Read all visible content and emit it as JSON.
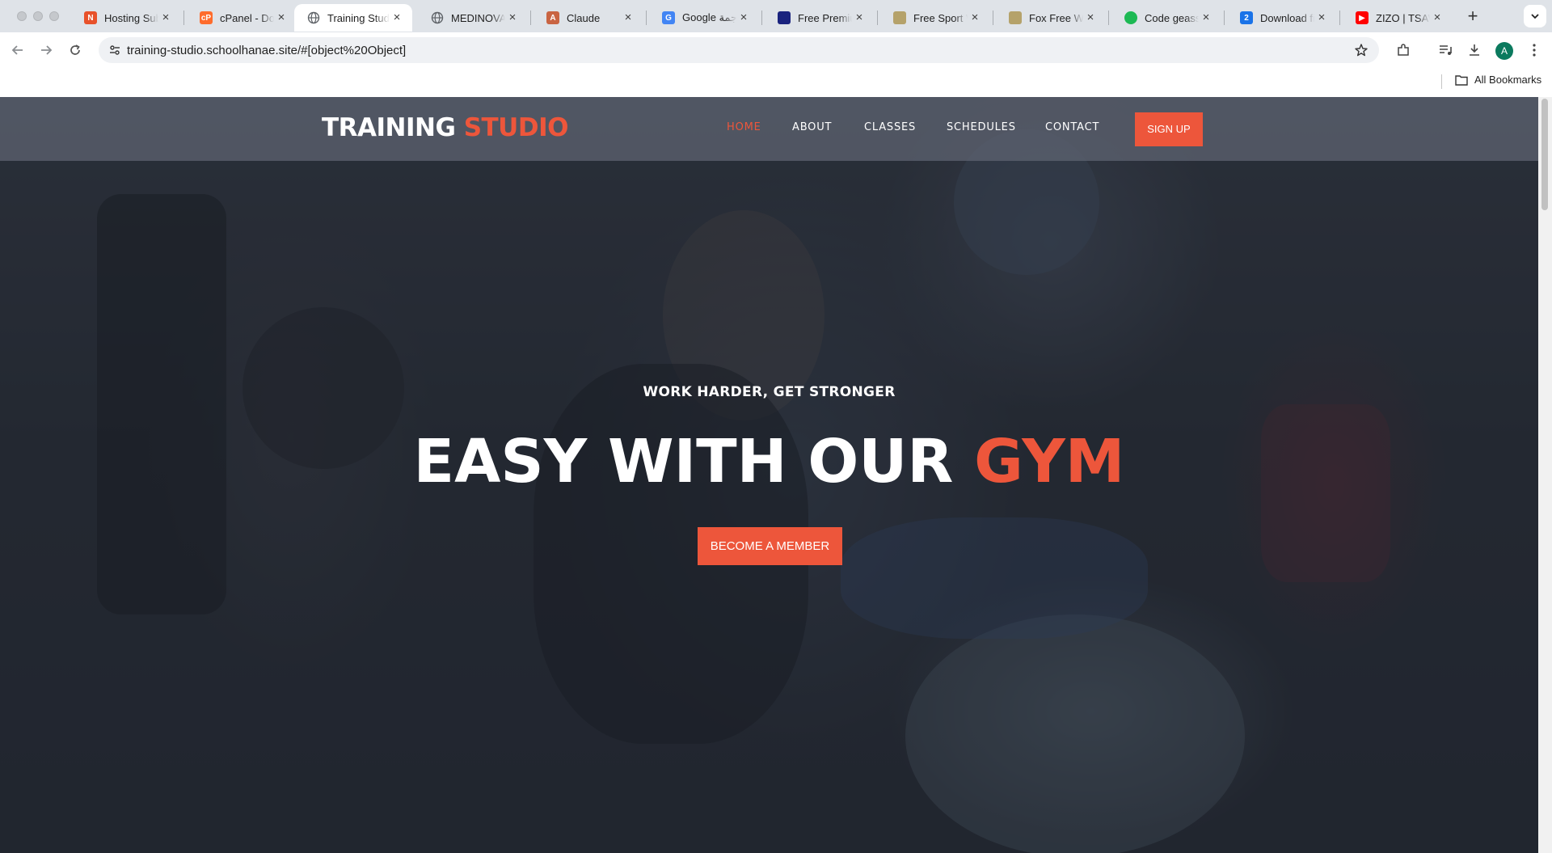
{
  "browser": {
    "tabs": [
      {
        "label": "Hosting Subs",
        "favicon": "hosting-icon",
        "color": "#e8512a",
        "active": false
      },
      {
        "label": "cPanel - Dom",
        "favicon": "cpanel-icon",
        "color": "#ff6c2c",
        "active": false
      },
      {
        "label": "Training Stud",
        "favicon": "globe-icon",
        "color": "#5f6368",
        "active": true
      },
      {
        "label": "MEDINOVA - ",
        "favicon": "globe-icon",
        "color": "#5f6368",
        "active": false
      },
      {
        "label": "Claude",
        "favicon": "claude-icon",
        "color": "#c96442",
        "active": false
      },
      {
        "label": "Google ترجمة",
        "favicon": "translate-icon",
        "color": "#4285f4",
        "active": false
      },
      {
        "label": "Free Premium",
        "favicon": "premium-icon",
        "color": "#1a237e",
        "active": false
      },
      {
        "label": "Free Sport W",
        "favicon": "sport-icon",
        "color": "#b5a26a",
        "active": false
      },
      {
        "label": "Fox Free Web",
        "favicon": "fox-icon",
        "color": "#b5a26a",
        "active": false
      },
      {
        "label": "Code geass",
        "favicon": "spotify-icon",
        "color": "#1db954",
        "active": false
      },
      {
        "label": "Download fil",
        "favicon": "download-site-icon",
        "color": "#1a73e8",
        "active": false
      },
      {
        "label": "ZIZO | TSAW",
        "favicon": "youtube-icon",
        "color": "#ff0000",
        "active": false
      }
    ],
    "url": "training-studio.schoolhanae.site/#[object%20Object]",
    "avatar_letter": "A",
    "bookmarks_label": "All Bookmarks"
  },
  "site": {
    "logo_main": "TRAINING ",
    "logo_accent": "STUDIO",
    "nav": [
      {
        "label": "HOME",
        "active": true
      },
      {
        "label": "ABOUT",
        "active": false
      },
      {
        "label": "CLASSES",
        "active": false
      },
      {
        "label": "SCHEDULES",
        "active": false
      },
      {
        "label": "CONTACT",
        "active": false
      }
    ],
    "signup_label": "SIGN UP",
    "hero": {
      "subtitle": "WORK HARDER, GET STRONGER",
      "title_main": "EASY WITH OUR ",
      "title_accent": "GYM",
      "cta_label": "BECOME A MEMBER"
    },
    "accent_color": "#ed563b"
  }
}
